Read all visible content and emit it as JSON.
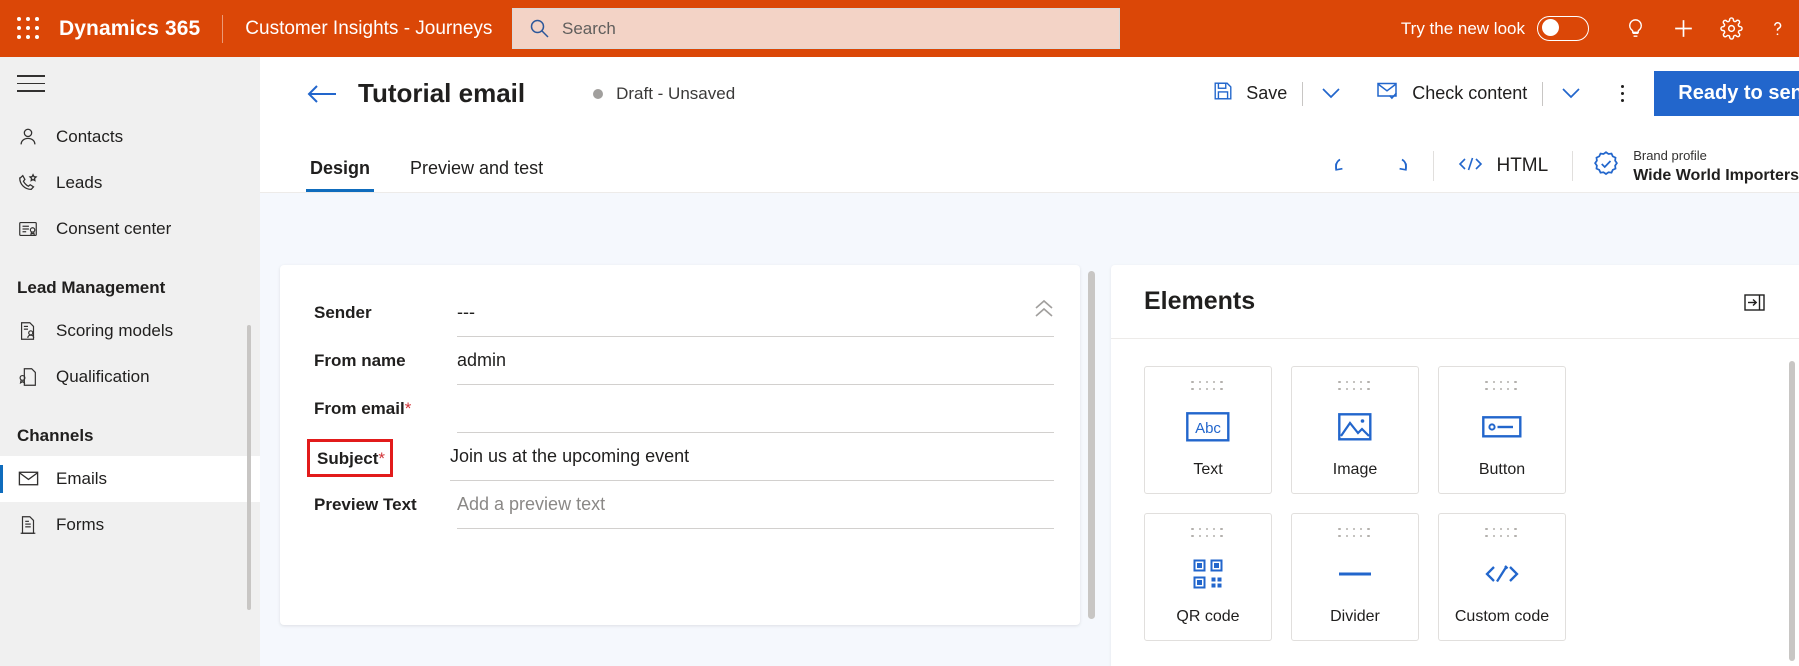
{
  "topbar": {
    "waffle_icon": "app-launcher-icon",
    "brand": "Dynamics 365",
    "app_name": "Customer Insights - Journeys",
    "search": {
      "placeholder": "Search",
      "icon": "search-icon"
    },
    "new_look": {
      "label": "Try the new look",
      "state": "off"
    },
    "icons": [
      "lightbulb-icon",
      "plus-icon",
      "gear-icon",
      "question-icon"
    ]
  },
  "sidebar": {
    "hamburger_icon": "hamburger-icon",
    "items": [
      {
        "label": "Contacts",
        "icon": "person-icon",
        "selected": false
      },
      {
        "label": "Leads",
        "icon": "lead-phone-icon",
        "selected": false
      },
      {
        "label": "Consent center",
        "icon": "consent-document-icon",
        "selected": false
      }
    ],
    "groups": [
      {
        "title": "Lead Management",
        "items": [
          {
            "label": "Scoring models",
            "icon": "scoring-model-icon",
            "selected": false
          },
          {
            "label": "Qualification",
            "icon": "qualification-icon",
            "selected": false
          }
        ]
      },
      {
        "title": "Channels",
        "items": [
          {
            "label": "Emails",
            "icon": "envelope-icon",
            "selected": true
          },
          {
            "label": "Forms",
            "icon": "form-icon",
            "selected": false
          }
        ]
      }
    ]
  },
  "command_bar": {
    "back_icon": "back-arrow-icon",
    "title": "Tutorial email",
    "status": "Draft - Unsaved",
    "save": {
      "label": "Save",
      "icon": "save-disk-icon"
    },
    "check_content": {
      "label": "Check content",
      "icon": "envelope-check-icon"
    },
    "chevron_icon": "chevron-down-icon",
    "overflow_icon": "more-options-icon",
    "primary_action": "Ready to send"
  },
  "tabs": [
    {
      "label": "Design",
      "active": true
    },
    {
      "label": "Preview and test",
      "active": false
    }
  ],
  "toolbar": {
    "undo_icon": "undo-icon",
    "redo_icon": "redo-icon",
    "html_label": "HTML",
    "html_icon": "code-icon",
    "brand_profile": {
      "caption": "Brand profile",
      "name": "Wide World Importers",
      "icon": "verified-badge-icon"
    }
  },
  "email_header_form": {
    "collapse_icon": "chevron-double-up-icon",
    "fields": [
      {
        "label": "Sender",
        "required": false,
        "value": "---",
        "placeholder": "",
        "blurred": false,
        "highlighted": false
      },
      {
        "label": "From name",
        "required": false,
        "value": "admin",
        "placeholder": "",
        "blurred": false,
        "highlighted": false
      },
      {
        "label": "From email",
        "required": true,
        "value": "",
        "placeholder": "",
        "blurred": true,
        "highlighted": false
      },
      {
        "label": "Subject",
        "required": true,
        "value": "Join us at the upcoming event",
        "placeholder": "",
        "blurred": false,
        "highlighted": true
      },
      {
        "label": "Preview Text",
        "required": false,
        "value": "",
        "placeholder": "Add a preview text",
        "blurred": false,
        "highlighted": false
      }
    ]
  },
  "elements_panel": {
    "title": "Elements",
    "collapse_icon": "collapse-panel-icon",
    "items": [
      {
        "label": "Text",
        "icon": "abc-text-icon"
      },
      {
        "label": "Image",
        "icon": "image-icon"
      },
      {
        "label": "Button",
        "icon": "button-icon"
      },
      {
        "label": "QR code",
        "icon": "qr-code-icon"
      },
      {
        "label": "Divider",
        "icon": "divider-icon"
      },
      {
        "label": "Custom code",
        "icon": "custom-code-icon"
      }
    ]
  },
  "colors": {
    "brand_orange": "#DB4707",
    "accent_blue": "#0F6CBD",
    "primary_button": "#2266CC",
    "required_red": "#D13438",
    "highlight_red": "#E21B1B",
    "search_field": "#F3D3C6"
  }
}
